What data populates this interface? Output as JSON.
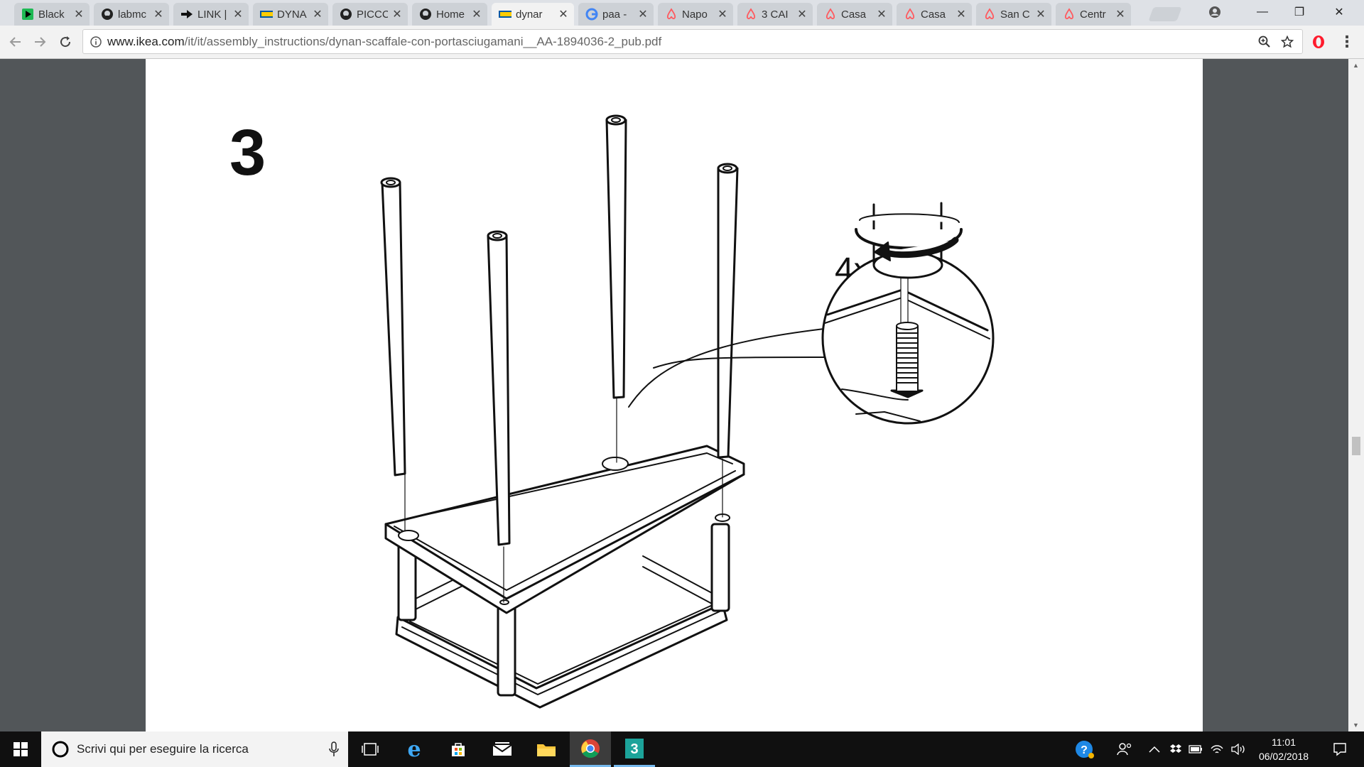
{
  "window": {
    "minimize": "—",
    "restore": "❐",
    "close": "✕",
    "profile_icon": "account-circle-icon"
  },
  "tabs": [
    {
      "title": "Black",
      "icon": "green-play-icon",
      "active": false
    },
    {
      "title": "labmc",
      "icon": "github-icon",
      "active": false
    },
    {
      "title": "LINK |",
      "icon": "arrow-link-icon",
      "active": false
    },
    {
      "title": "DYNA",
      "icon": "ikea-icon",
      "active": false
    },
    {
      "title": "PICCC",
      "icon": "github-icon",
      "active": false
    },
    {
      "title": "Home",
      "icon": "github-icon",
      "active": false
    },
    {
      "title": "dynar",
      "icon": "ikea-icon",
      "active": true
    },
    {
      "title": "paa -",
      "icon": "google-icon",
      "active": false
    },
    {
      "title": "Napo",
      "icon": "airbnb-icon",
      "active": false
    },
    {
      "title": "3 CAI",
      "icon": "airbnb-icon",
      "active": false
    },
    {
      "title": "Casa",
      "icon": "airbnb-icon",
      "active": false
    },
    {
      "title": "Casa",
      "icon": "airbnb-icon",
      "active": false
    },
    {
      "title": "San C",
      "icon": "airbnb-icon",
      "active": false
    },
    {
      "title": "Centr",
      "icon": "airbnb-icon",
      "active": false
    }
  ],
  "toolbar": {
    "url_host": "www.ikea.com",
    "url_path": "/it/it/assembly_instructions/dynan-scaffale-con-portasciugamani__AA-1894036-2_pub.pdf"
  },
  "document": {
    "step_number": "3",
    "count_label": "4x"
  },
  "taskbar": {
    "search_placeholder": "Scrivi qui per eseguire la ricerca",
    "time": "11:01",
    "date": "06/02/2018"
  },
  "colors": {
    "tabstrip": "#dee1e6",
    "toolbar": "#f2f2f2",
    "pdf_background": "#525659",
    "taskbar": "#101010",
    "ikea_yellow": "#ffcc00",
    "airbnb_red": "#ff5a5f"
  }
}
